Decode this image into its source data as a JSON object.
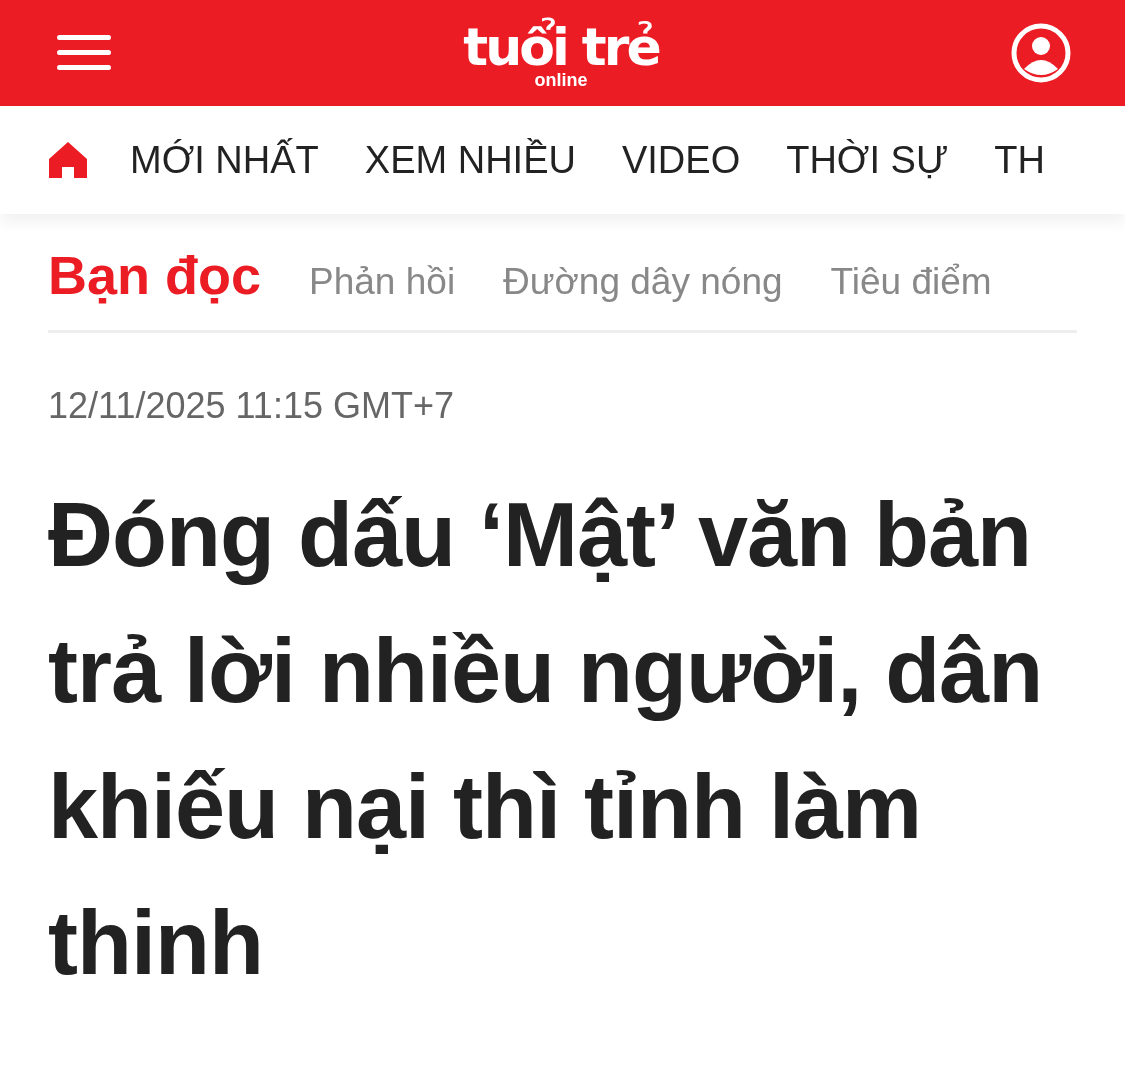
{
  "header": {
    "logo": {
      "main": "tuổi trẻ",
      "sub": "online"
    }
  },
  "nav": {
    "items": [
      {
        "label": "MỚI NHẤT"
      },
      {
        "label": "XEM NHIỀU"
      },
      {
        "label": "VIDEO"
      },
      {
        "label": "THỜI SỰ"
      },
      {
        "label": "TH"
      }
    ]
  },
  "section": {
    "title": "Bạn đọc",
    "subitems": [
      "Phản hồi",
      "Đường dây nóng",
      "Tiêu điểm"
    ]
  },
  "article": {
    "date": "12/11/2025 11:15 GMT+7",
    "headline": "Đóng dấu ‘Mật’ văn bản trả lời nhiều người, dân khiếu nại thì tỉnh làm thinh"
  }
}
